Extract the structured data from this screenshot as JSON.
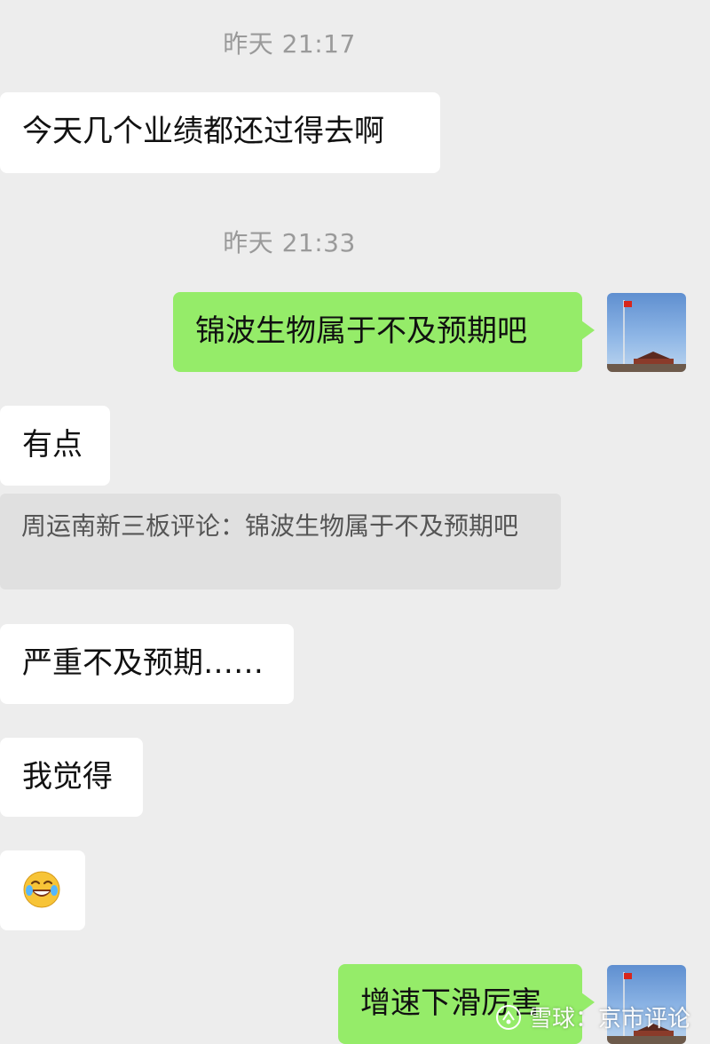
{
  "chat": {
    "timestamps": [
      "昨天 21:17",
      "昨天 21:33"
    ],
    "messages": [
      {
        "side": "left",
        "text": "今天几个业绩都还过得去啊"
      },
      {
        "side": "right",
        "text": "锦波生物属于不及预期吧"
      },
      {
        "side": "left",
        "text": "有点"
      },
      {
        "side": "quote",
        "text": "周运南新三板评论：锦波生物属于不及预期吧"
      },
      {
        "side": "left",
        "text": "严重不及预期……"
      },
      {
        "side": "left",
        "text": "我觉得"
      },
      {
        "side": "left",
        "emoji": "laughing-with-tears"
      },
      {
        "side": "right",
        "text": "增速下滑厉害"
      }
    ]
  },
  "watermark": {
    "text": "雪球：京市评论"
  },
  "colors": {
    "background": "#ededed",
    "incoming_bubble": "#ffffff",
    "outgoing_bubble": "#95ec69",
    "quote_block": "#e0e0e0",
    "timestamp_text": "#9a9a9a"
  }
}
